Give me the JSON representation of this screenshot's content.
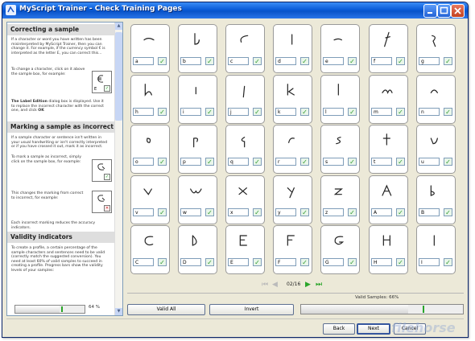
{
  "window": {
    "title": "MyScript Trainer - Check Training Pages",
    "colors": {
      "titlebar": "#0a5bd8",
      "check": "#2f9a2f",
      "marker": "#2aa52a"
    }
  },
  "sidebar": {
    "sections": [
      {
        "heading": "Correcting a sample"
      },
      {
        "heading": "Marking a sample as incorrect"
      },
      {
        "heading": "Validity indicators"
      }
    ],
    "p1": "If a character or word you have written has been misinterpreted by MyScript Trainer, then you can change it. For example, if the currency symbol € is interpreted as the letter E, you can correct this...",
    "p2": "To change a character, click on it above the sample box, for example:",
    "p3_bold": "The Label Edition",
    "p3": " dialog box is displayed. Use it to replace the incorrect character with the correct one, and click ",
    "p3_ok": "OK",
    "p4": "If a sample character or sentence isn't written in your usual handwriting or isn't correctly interpreted or if you have crossed it out, mark it as incorrect.",
    "p5": "To mark a sample as incorrect, simply click on the sample box, for example:",
    "p6": "This changes the marking from correct to incorrect, for example:",
    "p7": "Each incorrect marking reduces the accuracy indicators.",
    "p8": "To create a profile, a certain percentage of the sample characters and sentences need to be valid (correctly match the suggested conversion). You need at least 60% of valid samples to succeed in creating a profile. Progress bars show the validity levels of your samples:",
    "progress_pct": "64 %",
    "progress_value": 0.64,
    "demo_label": "E"
  },
  "samples": [
    "a",
    "b",
    "c",
    "d",
    "e",
    "f",
    "g",
    "h",
    "i",
    "j",
    "k",
    "l",
    "m",
    "n",
    "o",
    "p",
    "q",
    "r",
    "s",
    "t",
    "u",
    "v",
    "w",
    "x",
    "y",
    "z",
    "A",
    "B",
    "C",
    "D",
    "E",
    "F",
    "G",
    "H",
    "I"
  ],
  "pager": {
    "page_text": "02/16"
  },
  "actions": {
    "valid_all": "Valid All",
    "invert": "Invert",
    "valid_samples_label": "Valid Samples: 66%",
    "valid_samples_value": 0.66
  },
  "footer": {
    "back": "Back",
    "next": "Next",
    "cancel": "Cancel"
  },
  "watermark": "filehorse"
}
